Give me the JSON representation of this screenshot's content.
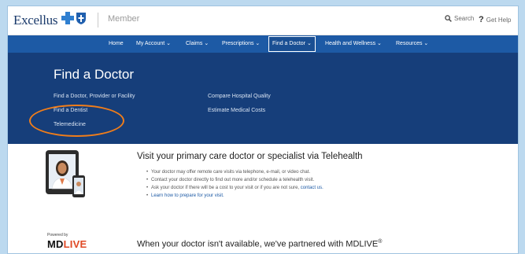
{
  "brand": {
    "logo_text": "Excellus",
    "section": "Member",
    "colors": {
      "nav_blue": "#1d5aa5",
      "hero_navy": "#163e7a",
      "highlight_orange": "#f07d1a",
      "link_blue": "#1d5aa5",
      "mdlive_red": "#e04a26"
    }
  },
  "utility": {
    "search_label": "Search",
    "help_label": "Get Help",
    "search_icon": "search-icon",
    "help_icon": "question-icon"
  },
  "nav": {
    "items": [
      {
        "label": "Home"
      },
      {
        "label": "My Account ⌄"
      },
      {
        "label": "Claims ⌄"
      },
      {
        "label": "Prescriptions ⌄"
      },
      {
        "label": "Find a Doctor ⌄"
      },
      {
        "label": "Health and Wellness ⌄"
      },
      {
        "label": "Resources ⌄"
      }
    ],
    "active": "Find a Doctor"
  },
  "hero": {
    "title": "Find a Doctor",
    "links_left": [
      "Find a Doctor, Provider or Facility",
      "Find a Dentist",
      "Telemedicine"
    ],
    "links_right": [
      "Compare Hospital Quality",
      "Estimate Medical Costs"
    ],
    "highlighted": "Telemedicine"
  },
  "telehealth": {
    "title": "Visit your primary care doctor or specialist via Telehealth",
    "bullets": [
      {
        "text": "Your doctor may offer remote care visits via telephone, e-mail, or video chat.",
        "link": ""
      },
      {
        "text": "Contact your doctor directly to find out more and/or schedule a telehealth visit.",
        "link": ""
      },
      {
        "text": "Ask your doctor if there will be a cost to your visit or if you are not sure, ",
        "link": "contact us."
      },
      {
        "text": "",
        "link": "Learn how to prepare for your visit."
      }
    ]
  },
  "mdlive": {
    "powered_by": "Powered by",
    "logo_md": "MD",
    "logo_live": "LIVE",
    "title": "When your doctor isn't available, we've partnered with MDLIVE",
    "reg": "®"
  }
}
